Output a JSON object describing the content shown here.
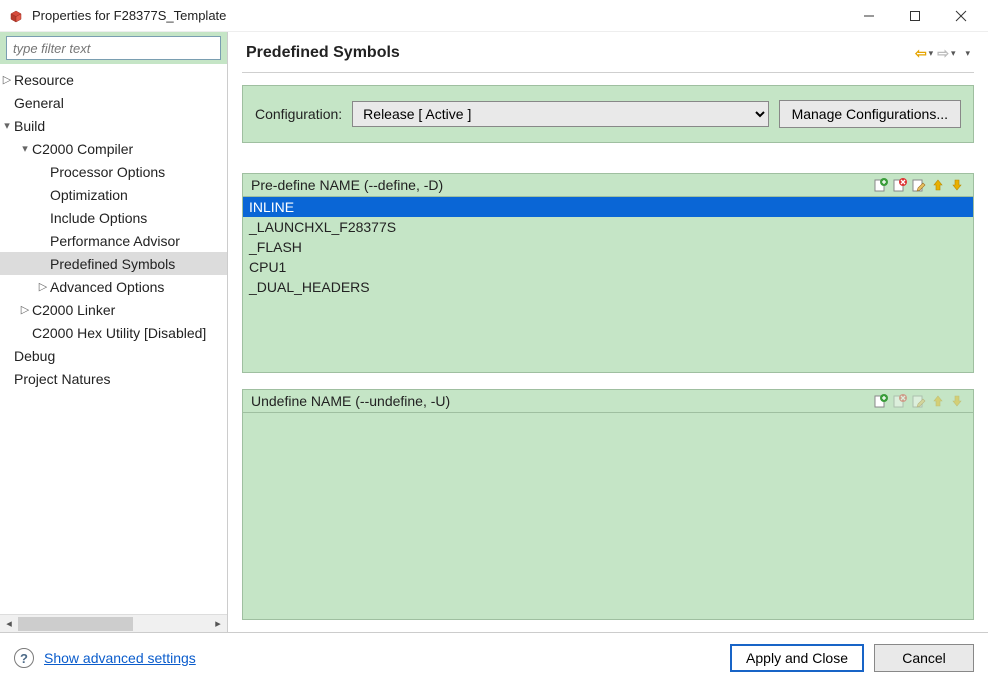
{
  "window": {
    "title": "Properties for F28377S_Template"
  },
  "filter": {
    "placeholder": "type filter text"
  },
  "tree": {
    "resource": "Resource",
    "general": "General",
    "build": "Build",
    "c2000_compiler": "C2000 Compiler",
    "processor_options": "Processor Options",
    "optimization": "Optimization",
    "include_options": "Include Options",
    "performance_advisor": "Performance Advisor",
    "predefined_symbols": "Predefined Symbols",
    "advanced_options": "Advanced Options",
    "c2000_linker": "C2000 Linker",
    "c2000_hex_utility": "C2000 Hex Utility  [Disabled]",
    "debug": "Debug",
    "project_natures": "Project Natures"
  },
  "main": {
    "heading": "Predefined Symbols",
    "config_label": "Configuration:",
    "config_selected": "Release  [ Active ]",
    "manage_label": "Manage Configurations..."
  },
  "defines": {
    "header": "Pre-define NAME (--define, -D)",
    "items": [
      "INLINE",
      "_LAUNCHXL_F28377S",
      "_FLASH",
      "CPU1",
      "_DUAL_HEADERS"
    ],
    "selected_index": 0
  },
  "undefines": {
    "header": "Undefine NAME (--undefine, -U)",
    "items": []
  },
  "bottom": {
    "advanced": "Show advanced settings",
    "apply": "Apply and Close",
    "cancel": "Cancel"
  }
}
